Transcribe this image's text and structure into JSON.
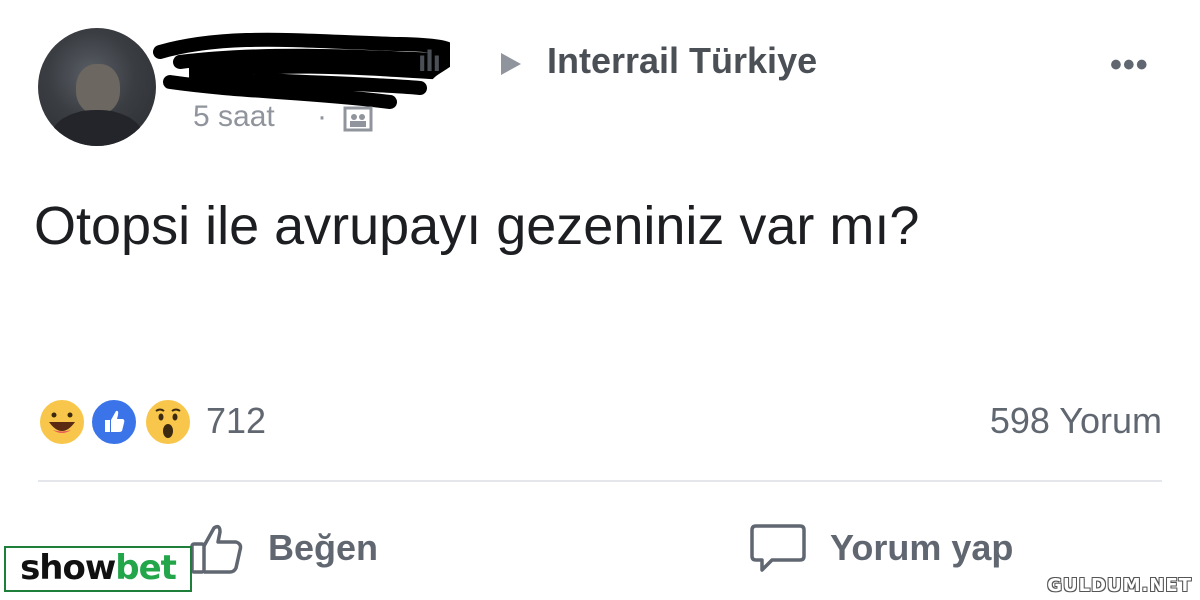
{
  "post": {
    "author_name_visible_fragment": "ılı",
    "group_name": "Interrail Türkiye",
    "time": "5 saat",
    "separator": "·",
    "text": "Otopsi ile avrupayı gezeniniz var mı?",
    "more_icon": "more-dots-icon",
    "audience_icon": "group-icon"
  },
  "reactions": {
    "icons": [
      "haha-icon",
      "like-icon",
      "wow-icon"
    ],
    "count": "712",
    "comments": "598 Yorum"
  },
  "actions": {
    "like_label": "Beğen",
    "comment_label": "Yorum yap"
  },
  "branding": {
    "logo_part1": "show",
    "logo_part2": "bet",
    "watermark": "GULDUM.NET",
    "colors": {
      "logo_green": "#23a54a",
      "text_gray": "#606770",
      "like_blue": "#3b74e8",
      "reaction_yellow": "#f7c64a"
    }
  }
}
